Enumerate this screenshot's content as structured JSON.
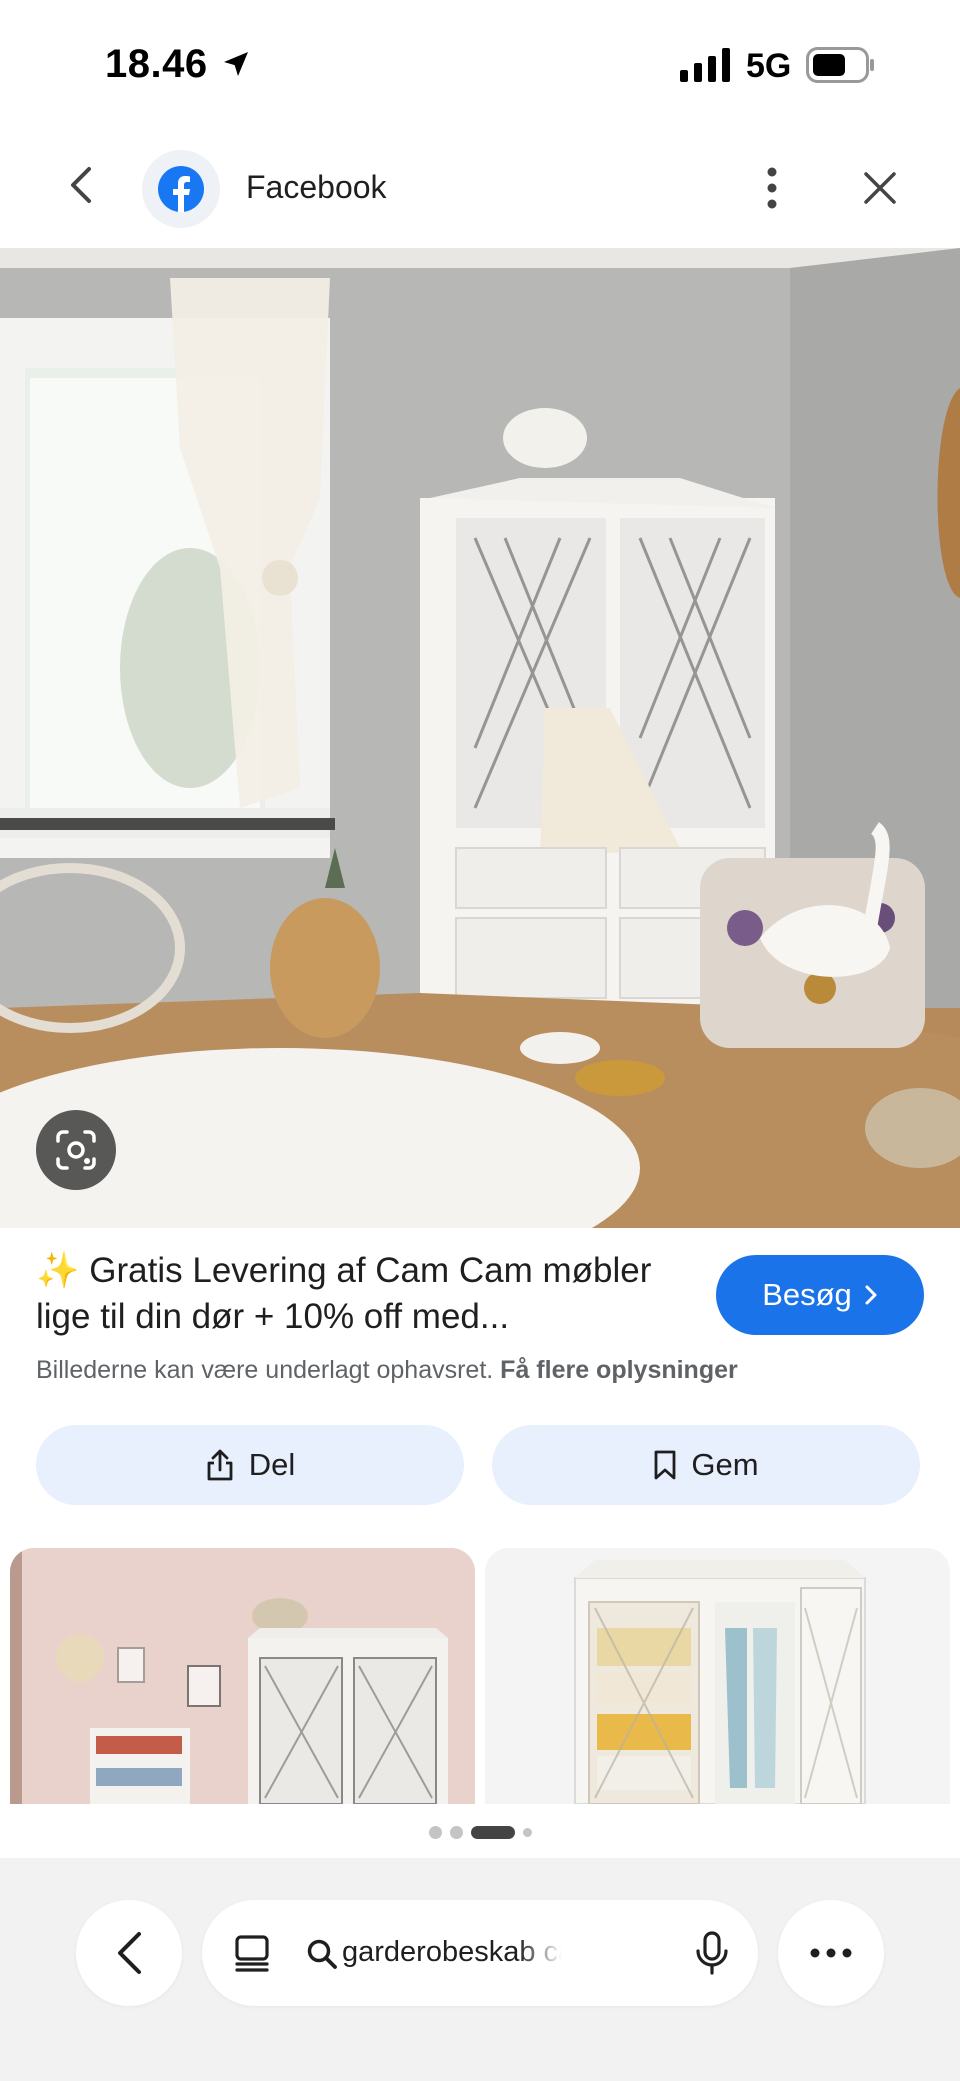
{
  "status_bar": {
    "time": "18.46",
    "network": "5G",
    "icons": [
      "location-arrow-icon",
      "cellular-signal-icon",
      "battery-icon"
    ]
  },
  "header": {
    "title": "Facebook",
    "icons": [
      "back-arrow-icon",
      "facebook-logo-icon",
      "more-vertical-icon",
      "close-icon"
    ]
  },
  "result": {
    "title": "✨ Gratis Levering af Cam Cam møbler lige til din dør + 10% off med...",
    "visit_label": "Besøg",
    "copyright_text": "Billederne kan være underlagt ophavsret.",
    "more_info_link": "Få flere oplysninger"
  },
  "actions": {
    "share_label": "Del",
    "save_label": "Gem"
  },
  "pagination": {
    "total": 4,
    "active_index": 2
  },
  "bottom_bar": {
    "search_query": "garderobeskab cam cam",
    "icons": [
      "back-chevron-icon",
      "tabs-icon",
      "search-icon",
      "microphone-icon",
      "more-horizontal-icon"
    ]
  },
  "colors": {
    "accent": "#1a73e8",
    "action_bg": "#e8effd",
    "facebook_blue": "#1877f2"
  }
}
